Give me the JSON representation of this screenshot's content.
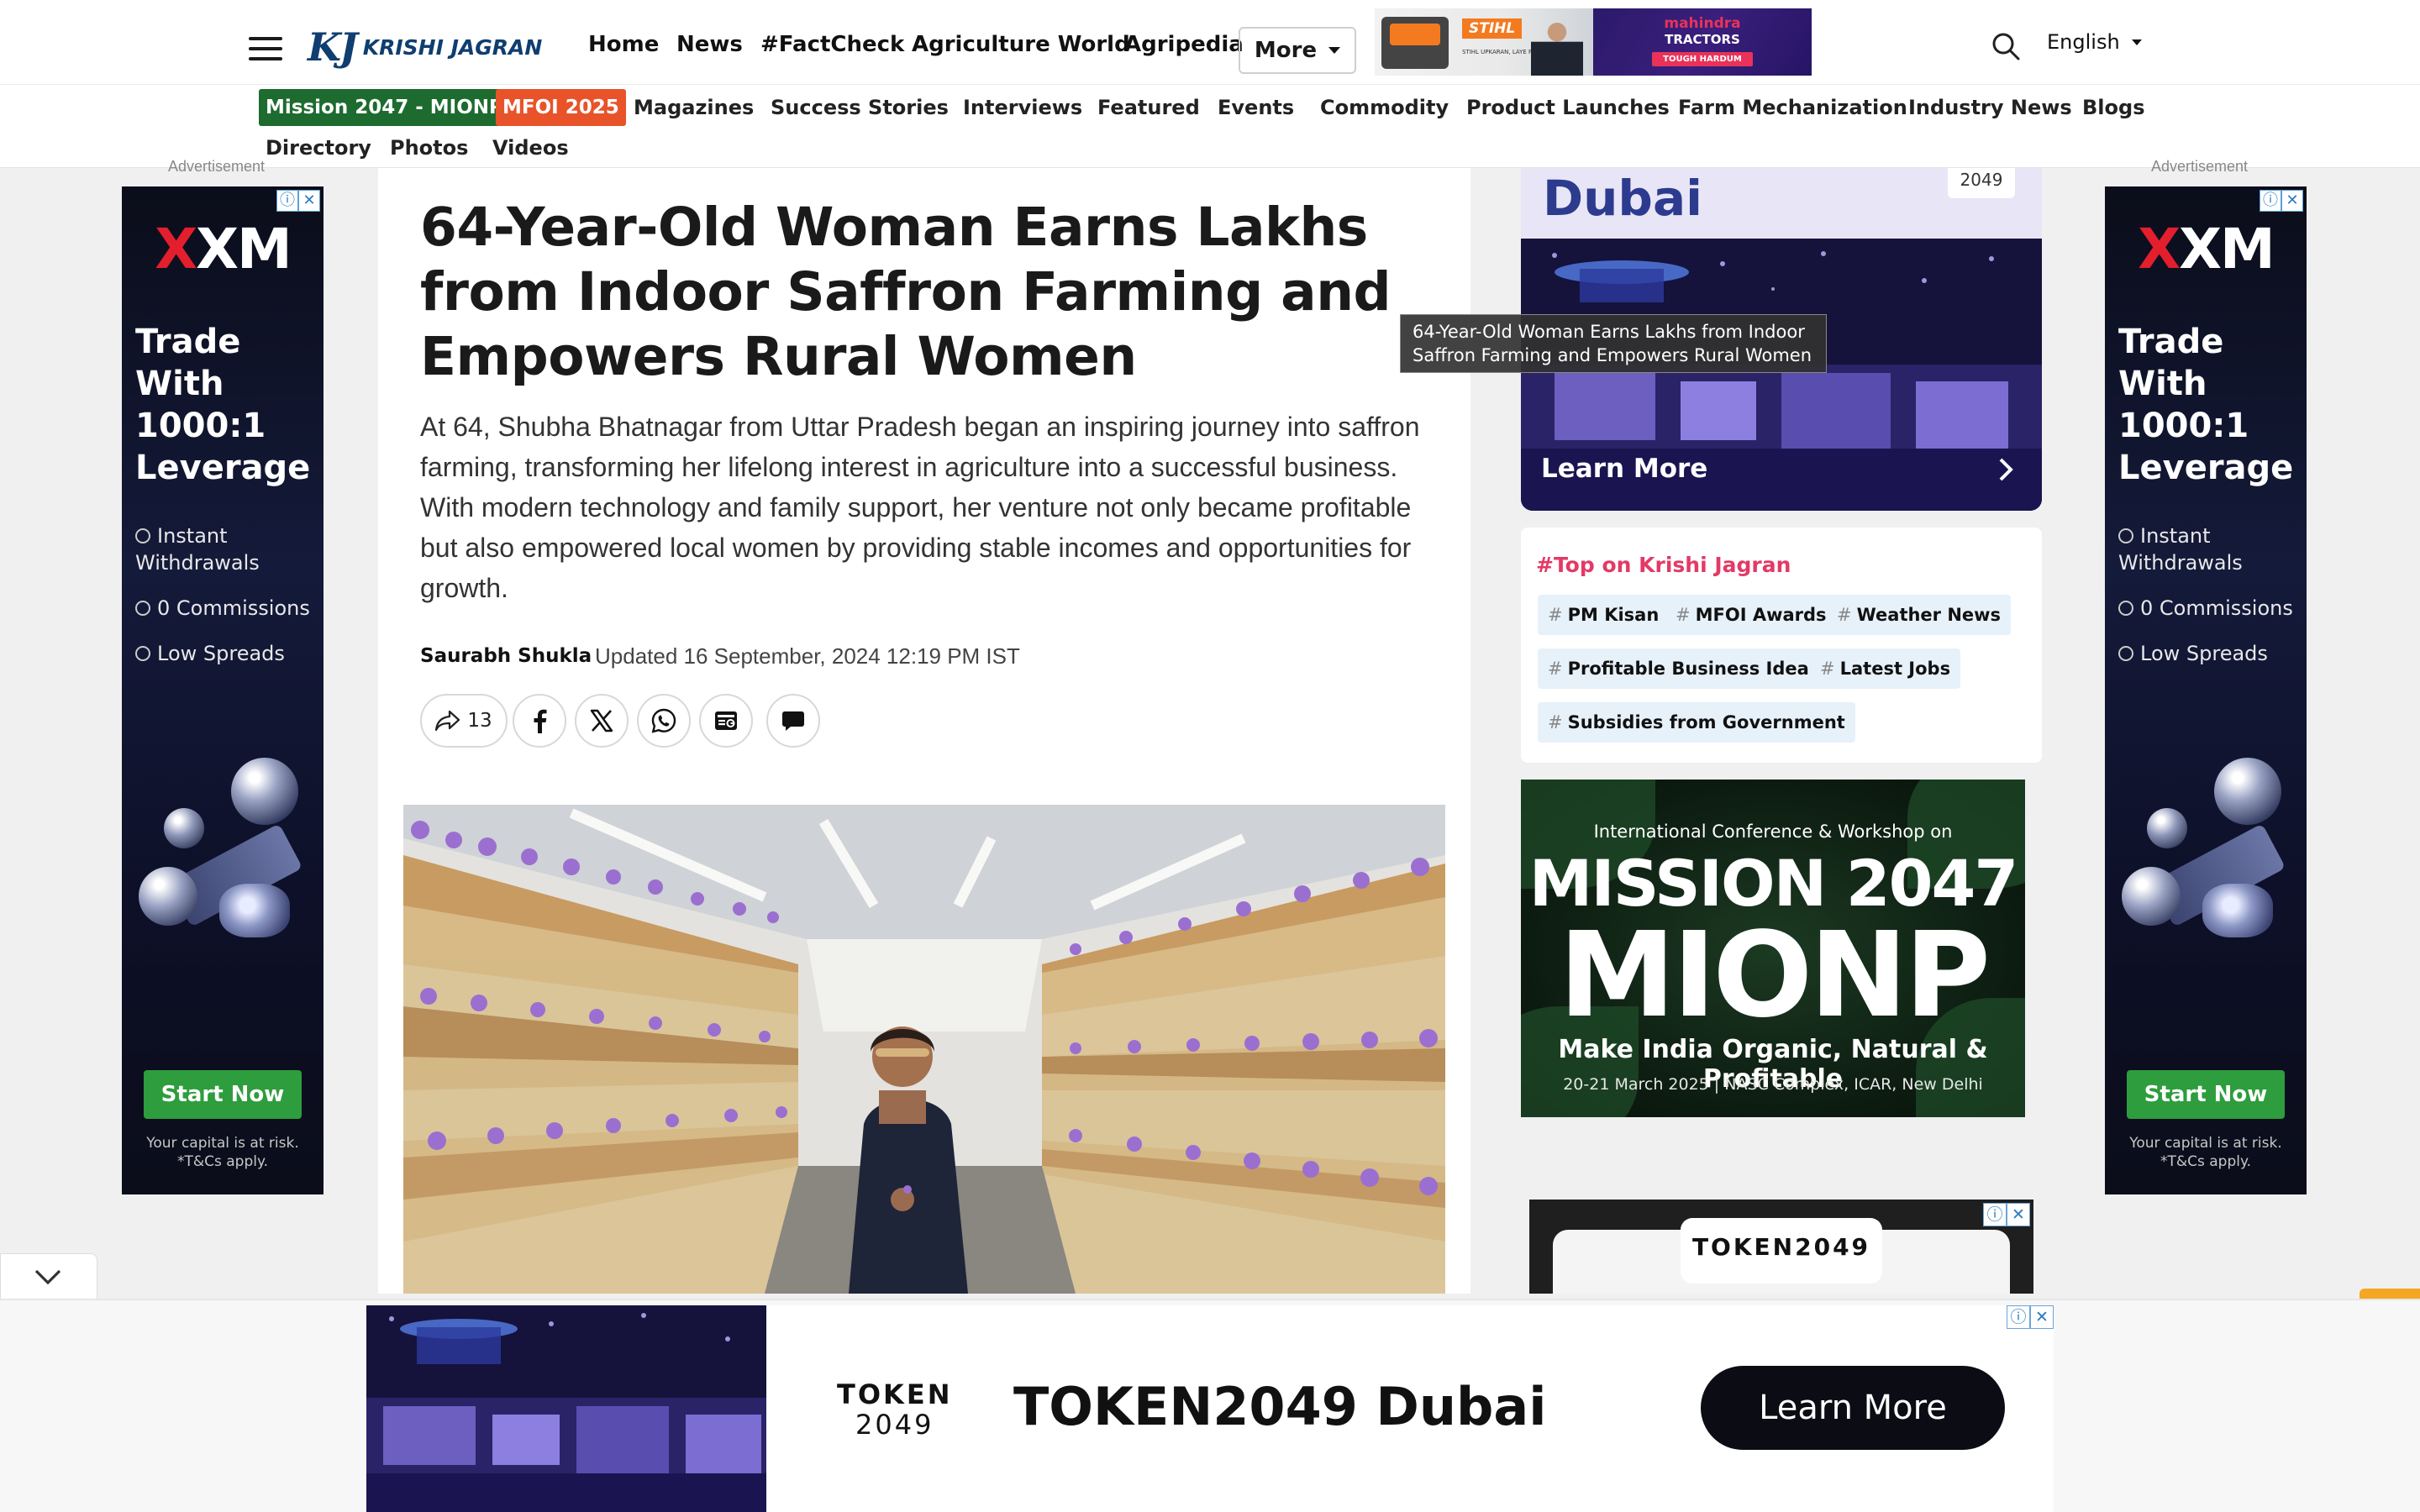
{
  "header": {
    "logo_mark": "KJ",
    "logo_name": "KRISHI JAGRAN",
    "nav": [
      "Home",
      "News",
      "#FactCheck",
      "Agriculture World",
      "Agripedia"
    ],
    "more_label": "More",
    "language": "English",
    "badges": [
      {
        "label": "Mission 2047 - MIONP",
        "color": "#1d6b2f"
      },
      {
        "label": "MFOI 2025",
        "color": "#e8532a"
      }
    ],
    "subnav": [
      "Magazines",
      "Success Stories",
      "Interviews",
      "Featured",
      "Events",
      "Commodity",
      "Product Launches",
      "Farm Mechanization",
      "Industry News",
      "Blogs"
    ],
    "subnav_row2": [
      "Directory",
      "Photos",
      "Videos"
    ]
  },
  "header_ads": {
    "stihl": {
      "brand": "STIHL",
      "tagline": "STIHL UPKARAN, LAYE PARIVARTAN"
    },
    "mahindra": {
      "line1": "mahindra",
      "line2": "TRACTORS",
      "line3": "TOUGH HARDUM"
    }
  },
  "side_ad": {
    "label": "Advertisement",
    "logo": "XM",
    "headline": [
      "Trade",
      "With",
      "1000:1",
      "Leverage"
    ],
    "features": [
      "Instant Withdrawals",
      "0 Commissions",
      "Low Spreads"
    ],
    "cta": "Start Now",
    "disclaimer": [
      "Your capital is at risk.",
      "*T&Cs apply."
    ]
  },
  "article": {
    "title": "64-Year-Old Woman Earns Lakhs from Indoor Saffron Farming and Empowers Rural Women",
    "summary": "At 64, Shubha Bhatnagar from Uttar Pradesh began an inspiring journey into saffron farming, transforming her lifelong interest in agriculture into a successful business. With modern technology and family support, her venture not only became profitable but also empowered local women by providing stable incomes and opportunities for growth.",
    "author": "Saurabh Shukla",
    "updated": "Updated 16 September, 2024 12:19 PM IST",
    "share_count": "13"
  },
  "tooltip": "64-Year-Old Woman Earns Lakhs from Indoor Saffron Farming and Empowers Rural Women",
  "dubai_ad": {
    "title": "Dubai",
    "year": "2049",
    "cta": "Learn More"
  },
  "top_box": {
    "heading": "#Top on Krishi Jagran",
    "tags": [
      "PM Kisan",
      "MFOI Awards",
      "Weather News",
      "Profitable Business Ideas",
      "Latest Jobs",
      "Subsidies from Government"
    ]
  },
  "mionp_ad": {
    "line1": "International Conference & Workshop on",
    "line2": "MISSION 2047",
    "line3": "MIONP",
    "line4": "Make India Organic, Natural & Profitable",
    "line5": "20-21 March 2025 | NASC Complex, ICAR, New Delhi"
  },
  "token_box": {
    "label": "TOKEN2049"
  },
  "bottom_banner": {
    "logo_top": "TOKEN",
    "logo_bottom": "2049",
    "headline": "TOKEN2049 Dubai",
    "cta": "Learn More"
  },
  "colors": {
    "accent_pink": "#e23a66",
    "brand_blue": "#0f3e70",
    "brand_green": "#2e9b3a",
    "xm_green": "#2e9d3d"
  }
}
